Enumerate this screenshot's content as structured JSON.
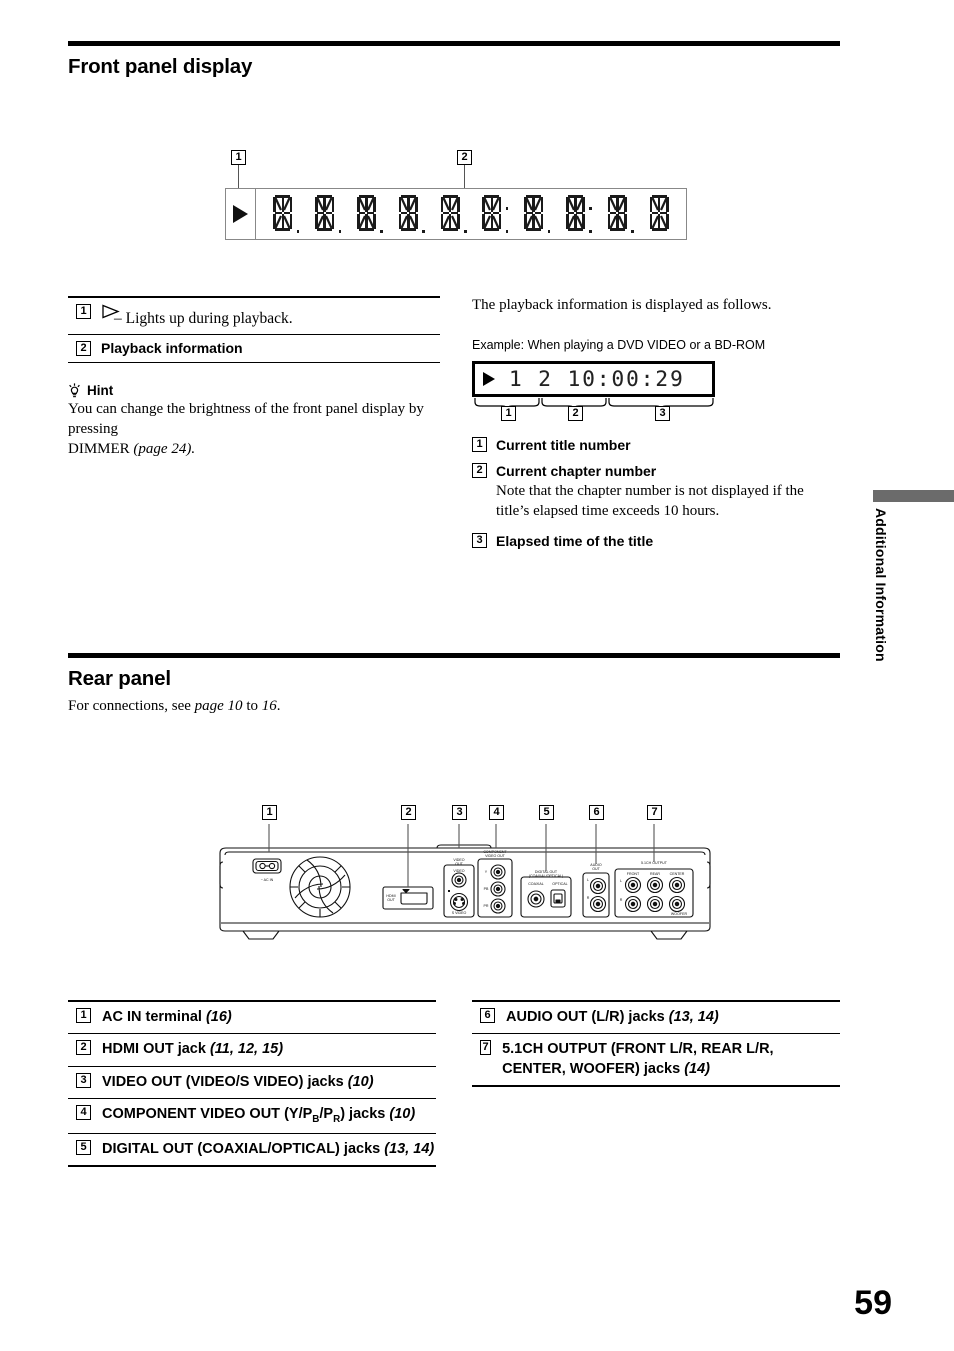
{
  "page": {
    "number": "59",
    "side_tab": "Additional Information",
    "side_tab_color": "#6b6b6b"
  },
  "front_panel": {
    "heading": "Front panel display",
    "diagram": {
      "callout_1": "1",
      "callout_2": "2",
      "play_icon": "play-triangle-icon",
      "cell_count": 10
    },
    "items": [
      {
        "num": "1",
        "icon": "play-outline-icon",
        "detail": "– Lights up during playback."
      },
      {
        "num": "2",
        "label": "Playback information"
      }
    ],
    "hint": {
      "icon": "lightbulb-icon",
      "title": "Hint",
      "body_1": "You can change the brightness of the front panel display by pressing",
      "body_2": "DIMMER ",
      "body_2_page": "(page 24)."
    }
  },
  "playback_info": {
    "intro": "The playback information is displayed as follows.",
    "example_caption": "Example: When playing a DVD VIDEO or a BD-ROM",
    "example_display": {
      "play_icon": "play-triangle-icon",
      "digits": "1  2  10:00:29",
      "title_number": "1",
      "chapter_number": "2",
      "elapsed_time": "10:00:29"
    },
    "brace_callouts": [
      "1",
      "2",
      "3"
    ],
    "items": [
      {
        "num": "1",
        "label": "Current title number",
        "note": ""
      },
      {
        "num": "2",
        "label": "Current chapter number",
        "note_1": "Note that the chapter number is not displayed if the",
        "note_2": "title’s elapsed time exceeds 10 hours."
      },
      {
        "num": "3",
        "label": "Elapsed time of the title",
        "note": ""
      }
    ]
  },
  "rear_panel": {
    "heading": "Rear panel",
    "intro_1": "For connections, see ",
    "intro_pages": "page 10",
    "intro_2": " to ",
    "intro_pages2": "16",
    "intro_3": ".",
    "diagram": {
      "callouts": [
        "1",
        "2",
        "3",
        "4",
        "5",
        "6",
        "7"
      ],
      "silk_labels": {
        "ac_in": "AC IN",
        "hdmi": "HDMI OUT",
        "video_out": "VIDEO OUT",
        "video": "VIDEO",
        "s_video": "S VIDEO",
        "component": "COMPONENT VIDEO OUT",
        "component_y": "Y",
        "component_pb": "PB",
        "component_pr": "PR",
        "digital_out": "DIGITAL OUT",
        "coaxial": "COAXIAL",
        "optical": "OPTICAL",
        "audio_out": "AUDIO OUT",
        "audio_l": "L",
        "audio_r": "R",
        "five_one": "5.1CH OUTPUT",
        "front": "FRONT",
        "rear": "REAR",
        "center": "CENTER",
        "woofer": "WOOFER"
      }
    },
    "jacks_left": [
      {
        "num": "1",
        "label": "AC IN terminal ",
        "pages": "(16)"
      },
      {
        "num": "2",
        "label": "HDMI OUT jack ",
        "pages": "(11, 12, 15)"
      },
      {
        "num": "3",
        "label": "VIDEO OUT (VIDEO/S VIDEO) jacks ",
        "pages": "(10)"
      },
      {
        "num": "4",
        "label": "COMPONENT VIDEO OUT (Y/PB/PR) jacks ",
        "pages": "(10)"
      },
      {
        "num": "5",
        "label": "DIGITAL OUT (COAXIAL/OPTICAL) jacks ",
        "pages": "(13, 14)"
      }
    ],
    "jacks_right": [
      {
        "num": "6",
        "label": "AUDIO OUT (L/R) jacks ",
        "pages": "(13, 14)"
      },
      {
        "num": "7",
        "label": "5.1CH OUTPUT (FRONT L/R, REAR L/R, CENTER, WOOFER) jacks ",
        "pages": "(14)"
      }
    ]
  }
}
